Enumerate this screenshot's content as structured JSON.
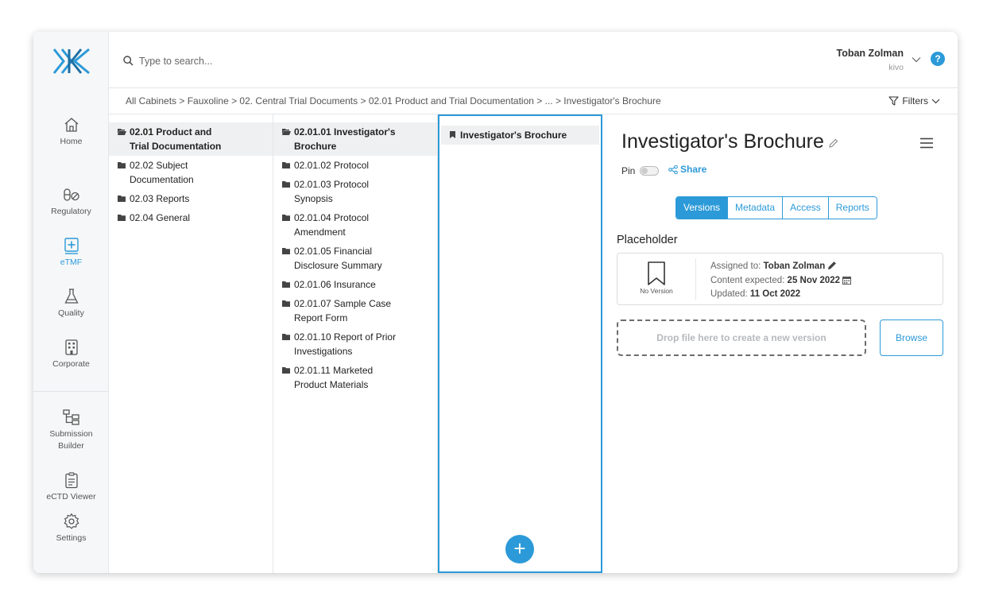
{
  "nav": {
    "items": [
      {
        "label": "Home",
        "icon": "home-icon"
      },
      {
        "label": "Regulatory",
        "icon": "pills-icon"
      },
      {
        "label": "eTMF",
        "icon": "medical-box-icon"
      },
      {
        "label": "Quality",
        "icon": "flask-icon"
      },
      {
        "label": "Corporate",
        "icon": "building-icon"
      },
      {
        "label_line1": "Submission",
        "label_line2": "Builder",
        "icon": "tree-icon"
      },
      {
        "label": "eCTD Viewer",
        "icon": "clipboard-icon"
      },
      {
        "label": "Settings",
        "icon": "gear-icon"
      }
    ]
  },
  "search": {
    "placeholder": "Type to search..."
  },
  "user": {
    "name": "Toban Zolman",
    "org": "kivo"
  },
  "help": {
    "label": "?"
  },
  "breadcrumb": "All Cabinets > Fauxoline > 02. Central Trial Documents > 02.01 Product and Trial Documentation > ... > Investigator's Brochure",
  "filters": {
    "label": "Filters"
  },
  "col1": [
    {
      "line1": "02.01 Product and",
      "line2": "Trial Documentation"
    },
    {
      "line1": "02.02 Subject",
      "line2": "Documentation"
    },
    {
      "line1": "02.03 Reports"
    },
    {
      "line1": "02.04 General"
    }
  ],
  "col2": [
    {
      "line1": "02.01.01 Investigator's",
      "line2": "Brochure"
    },
    {
      "line1": "02.01.02 Protocol"
    },
    {
      "line1": "02.01.03 Protocol",
      "line2": "Synopsis"
    },
    {
      "line1": "02.01.04 Protocol",
      "line2": "Amendment"
    },
    {
      "line1": "02.01.05 Financial",
      "line2": "Disclosure Summary"
    },
    {
      "line1": "02.01.06 Insurance"
    },
    {
      "line1": "02.01.07 Sample Case",
      "line2": "Report Form"
    },
    {
      "line1": "02.01.10 Report of Prior",
      "line2": "Investigations"
    },
    {
      "line1": "02.01.11 Marketed",
      "line2": "Product Materials"
    }
  ],
  "col3": [
    {
      "label": "Investigator's Brochure"
    }
  ],
  "add_button": {
    "label": "+"
  },
  "detail": {
    "title": "Investigator's Brochure",
    "pin_label": "Pin",
    "share_label": "Share",
    "tabs": [
      "Versions",
      "Metadata",
      "Access",
      "Reports"
    ],
    "active_tab": "Versions",
    "placeholder_heading": "Placeholder",
    "no_version": "No Version",
    "assigned_label": "Assigned to:",
    "assigned_value": "Toban Zolman",
    "expected_label": "Content expected:",
    "expected_value": "25 Nov 2022",
    "updated_label": "Updated:",
    "updated_value": "11 Oct 2022",
    "dropzone": "Drop file here to create a new version",
    "browse": "Browse"
  },
  "colors": {
    "accent": "#2c9ad8"
  }
}
